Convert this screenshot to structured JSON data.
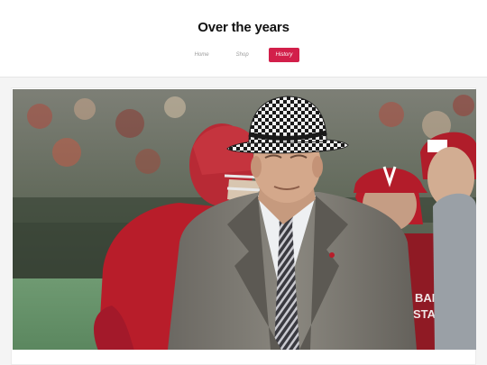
{
  "site": {
    "title": "Over the years"
  },
  "nav": {
    "items": [
      {
        "label": "Home",
        "active": false
      },
      {
        "label": "Shop",
        "active": false
      },
      {
        "label": "History",
        "active": true
      }
    ]
  },
  "colors": {
    "accent": "#d21f4a",
    "crimson_jersey": "#b81d2a"
  },
  "photo": {
    "icon": "photo"
  }
}
